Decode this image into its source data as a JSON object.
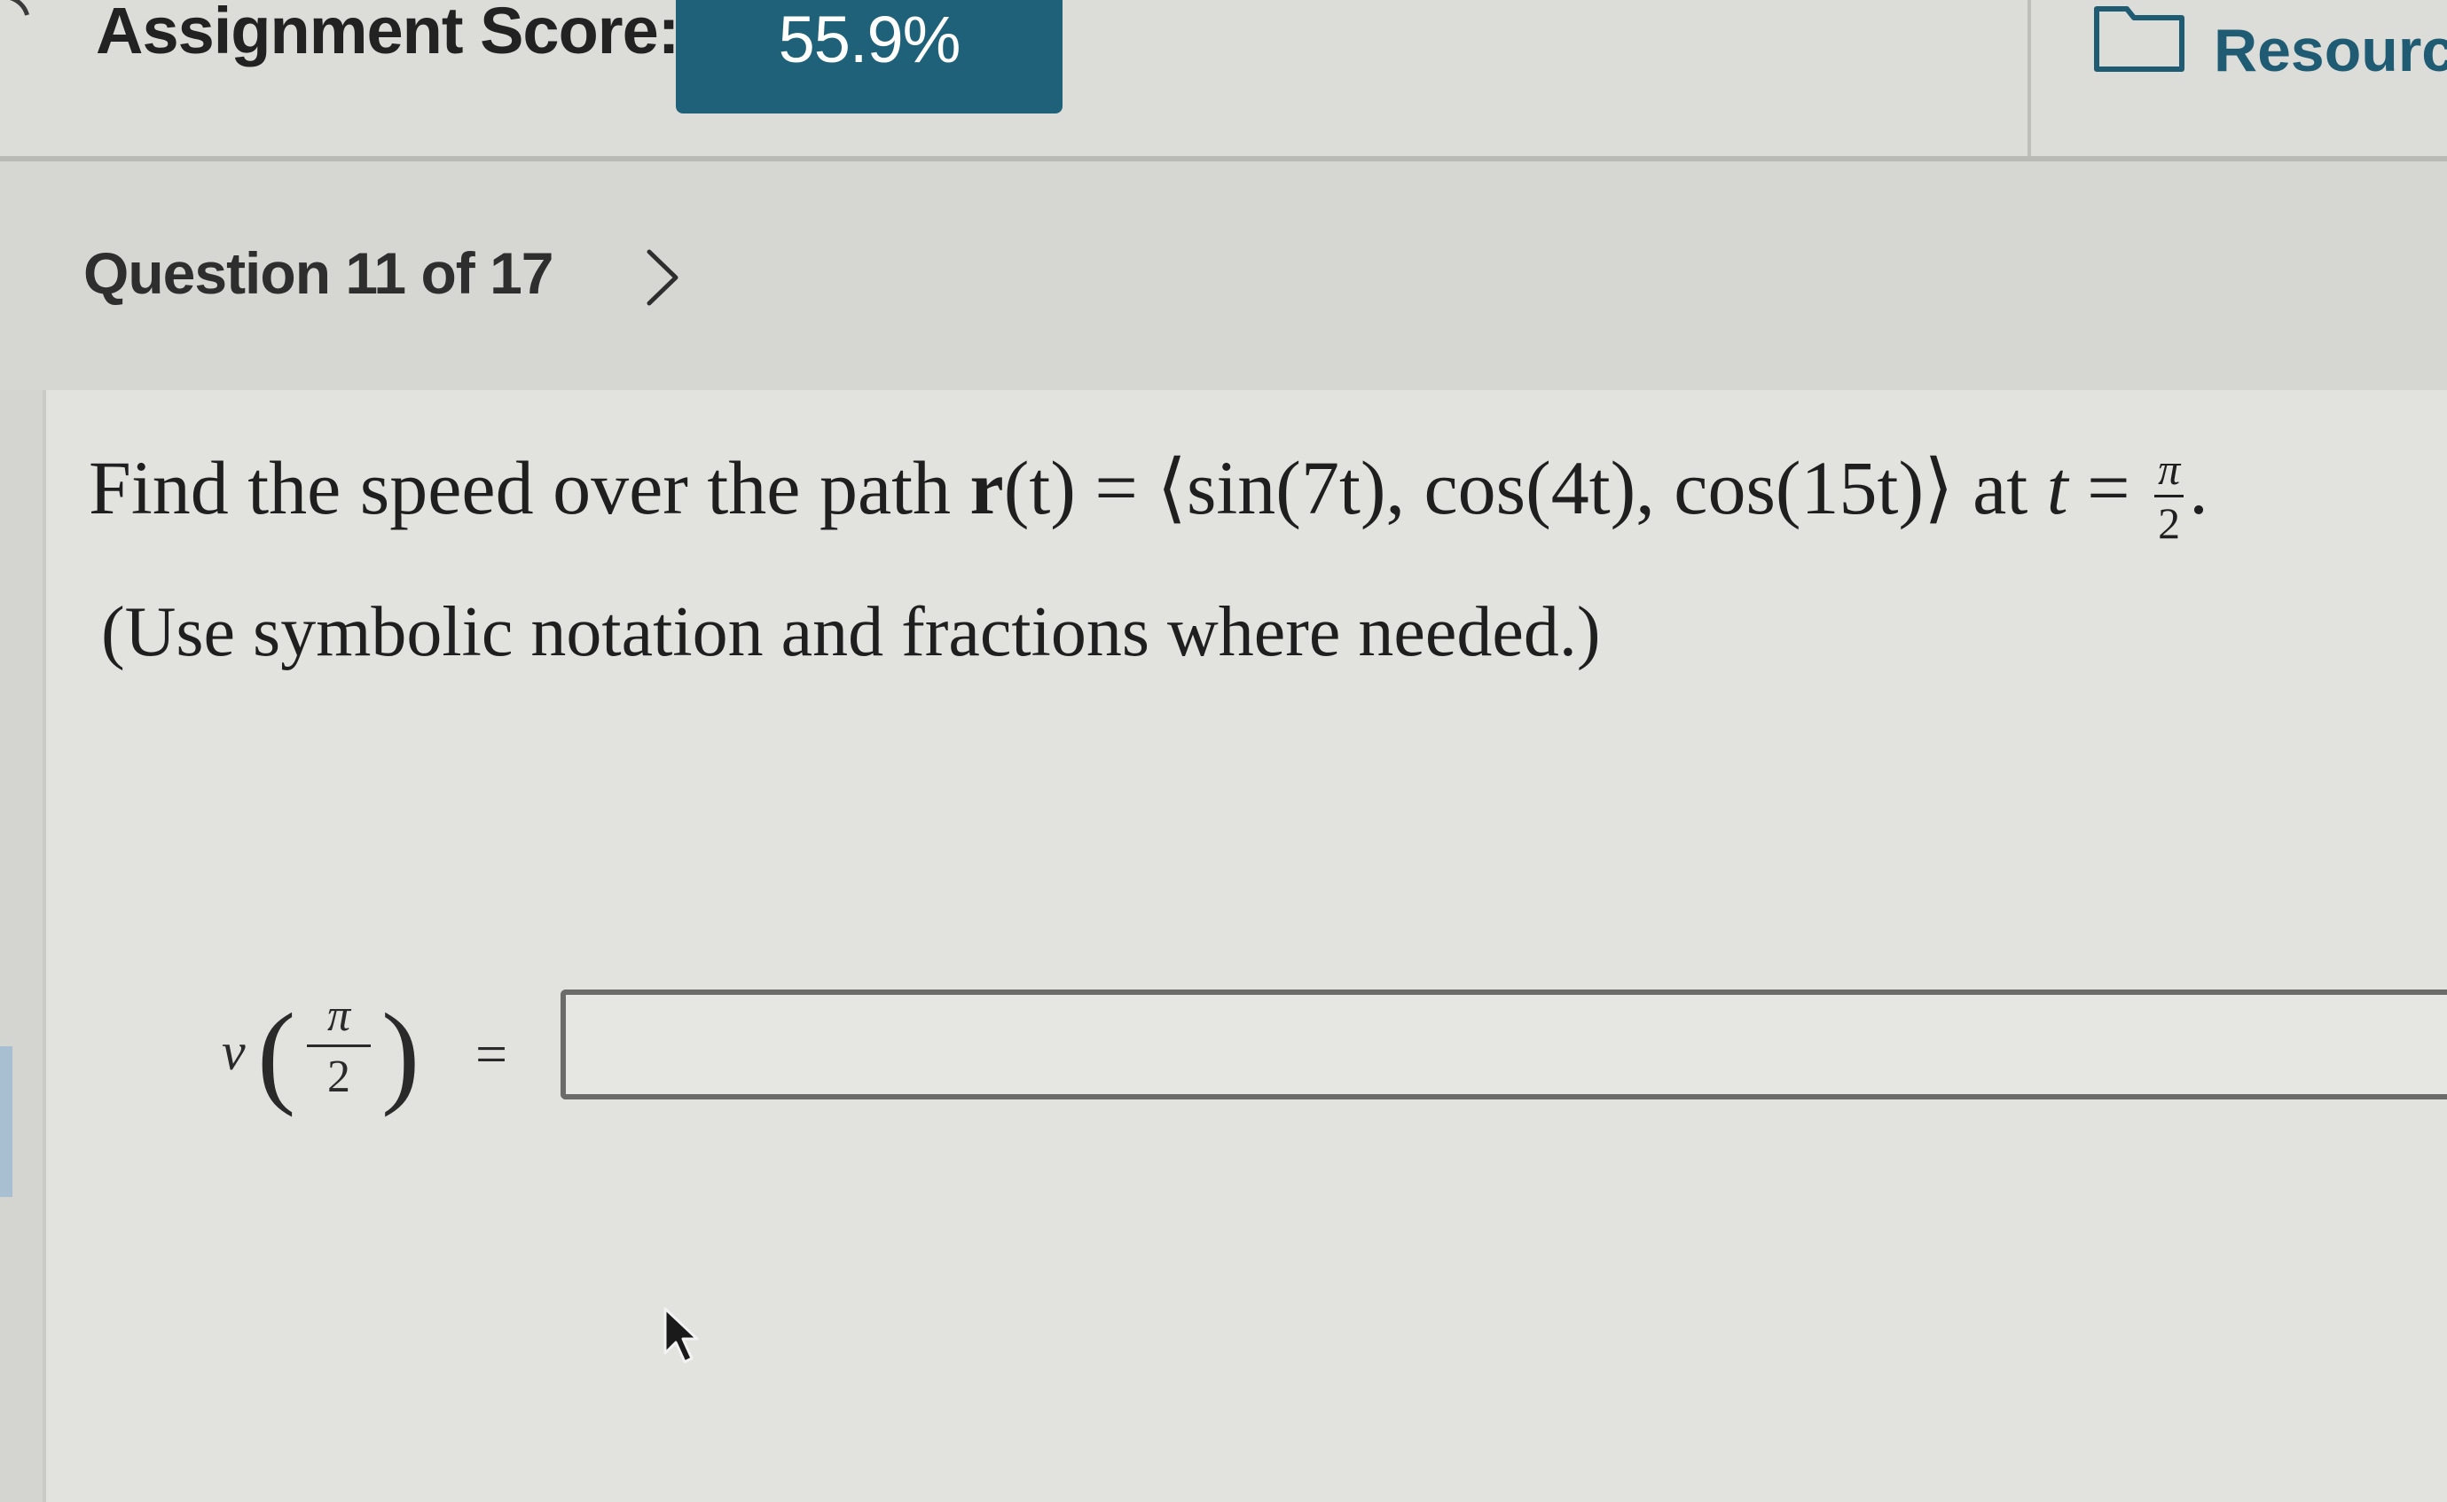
{
  "header": {
    "score_label": "Assignment Score:",
    "score_value": "55.9%",
    "resources_label": "Resource",
    "brand_color": "#1f6179"
  },
  "navigation": {
    "question_label": "Question 11 of 17",
    "next_icon": "chevron-right-icon"
  },
  "question": {
    "prompt_start": "Find the speed over the path ",
    "prompt_vector": "r",
    "prompt_arg": "(t) = ⟨sin(7t), cos(4t), cos(15t)⟩ at ",
    "prompt_var": "t",
    "prompt_eq": " = ",
    "prompt_frac_num": "π",
    "prompt_frac_den": "2",
    "prompt_end": ".",
    "hint": "(Use symbolic notation and fractions where needed.)"
  },
  "answer": {
    "label_var": "v",
    "label_open": "(",
    "label_frac_num": "π",
    "label_frac_den": "2",
    "label_close": ")",
    "label_eq": "=",
    "value": "",
    "placeholder": ""
  }
}
